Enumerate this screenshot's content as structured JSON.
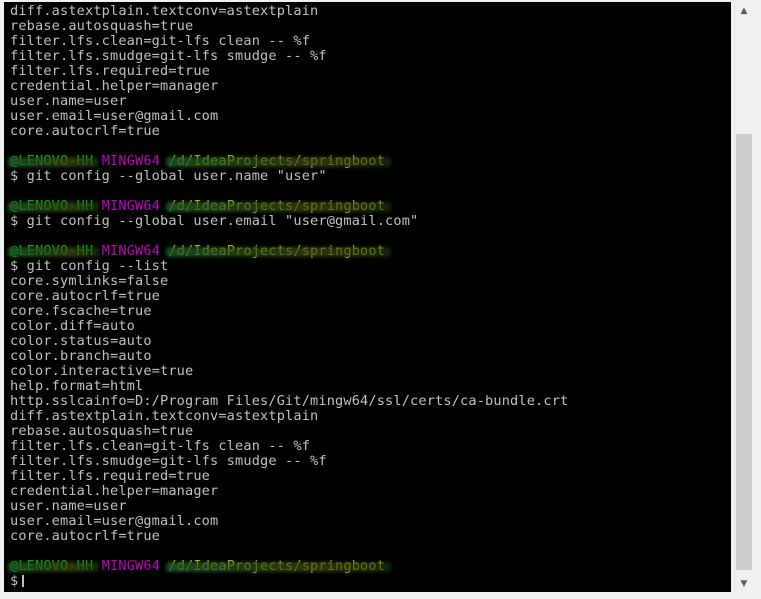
{
  "terminal": {
    "lines": [
      {
        "type": "text",
        "text": "diff.astextplain.textconv=astextplain"
      },
      {
        "type": "text",
        "text": "rebase.autosquash=true"
      },
      {
        "type": "text",
        "text": "filter.lfs.clean=git-lfs clean -- %f"
      },
      {
        "type": "text",
        "text": "filter.lfs.smudge=git-lfs smudge -- %f"
      },
      {
        "type": "text",
        "text": "filter.lfs.required=true"
      },
      {
        "type": "text",
        "text": "credential.helper=manager"
      },
      {
        "type": "text",
        "text": "user.name=user"
      },
      {
        "type": "text",
        "text": "user.email=user@gmail.com"
      },
      {
        "type": "text",
        "text": "core.autocrlf=true"
      },
      {
        "type": "blank",
        "text": ""
      },
      {
        "type": "prompt",
        "user": "@LENOVO-HH",
        "host": "MINGW64",
        "path": "/d/IdeaProjects/springboot"
      },
      {
        "type": "text",
        "text": "$ git config --global user.name \"user\""
      },
      {
        "type": "blank",
        "text": ""
      },
      {
        "type": "prompt",
        "user": "@LENOVO-HH",
        "host": "MINGW64",
        "path": "/d/IdeaProjects/springboot"
      },
      {
        "type": "text",
        "text": "$ git config --global user.email \"user@gmail.com\""
      },
      {
        "type": "blank",
        "text": ""
      },
      {
        "type": "prompt",
        "user": "@LENOVO-HH",
        "host": "MINGW64",
        "path": "/d/IdeaProjects/springboot"
      },
      {
        "type": "text",
        "text": "$ git config --list"
      },
      {
        "type": "text",
        "text": "core.symlinks=false"
      },
      {
        "type": "text",
        "text": "core.autocrlf=true"
      },
      {
        "type": "text",
        "text": "core.fscache=true"
      },
      {
        "type": "text",
        "text": "color.diff=auto"
      },
      {
        "type": "text",
        "text": "color.status=auto"
      },
      {
        "type": "text",
        "text": "color.branch=auto"
      },
      {
        "type": "text",
        "text": "color.interactive=true"
      },
      {
        "type": "text",
        "text": "help.format=html"
      },
      {
        "type": "text",
        "text": "http.sslcainfo=D:/Program Files/Git/mingw64/ssl/certs/ca-bundle.crt"
      },
      {
        "type": "text",
        "text": "diff.astextplain.textconv=astextplain"
      },
      {
        "type": "text",
        "text": "rebase.autosquash=true"
      },
      {
        "type": "text",
        "text": "filter.lfs.clean=git-lfs clean -- %f"
      },
      {
        "type": "text",
        "text": "filter.lfs.smudge=git-lfs smudge -- %f"
      },
      {
        "type": "text",
        "text": "filter.lfs.required=true"
      },
      {
        "type": "text",
        "text": "credential.helper=manager"
      },
      {
        "type": "text",
        "text": "user.name=user"
      },
      {
        "type": "text",
        "text": "user.email=user@gmail.com"
      },
      {
        "type": "text",
        "text": "core.autocrlf=true"
      },
      {
        "type": "blank",
        "text": ""
      },
      {
        "type": "prompt",
        "user": "@LENOVO-HH",
        "host": "MINGW64",
        "path": "/d/IdeaProjects/springboot"
      },
      {
        "type": "input",
        "text": "$"
      }
    ]
  },
  "scrollbar": {
    "up_icon": "triangle-up-icon",
    "down_icon": "triangle-down-icon",
    "up_glyph": "▲",
    "down_glyph": "▼"
  },
  "colors": {
    "background": "#000000",
    "text": "#c0c0c0",
    "prompt_user": "#00c000",
    "prompt_host": "#c000c0",
    "prompt_path": "#c0c000"
  }
}
